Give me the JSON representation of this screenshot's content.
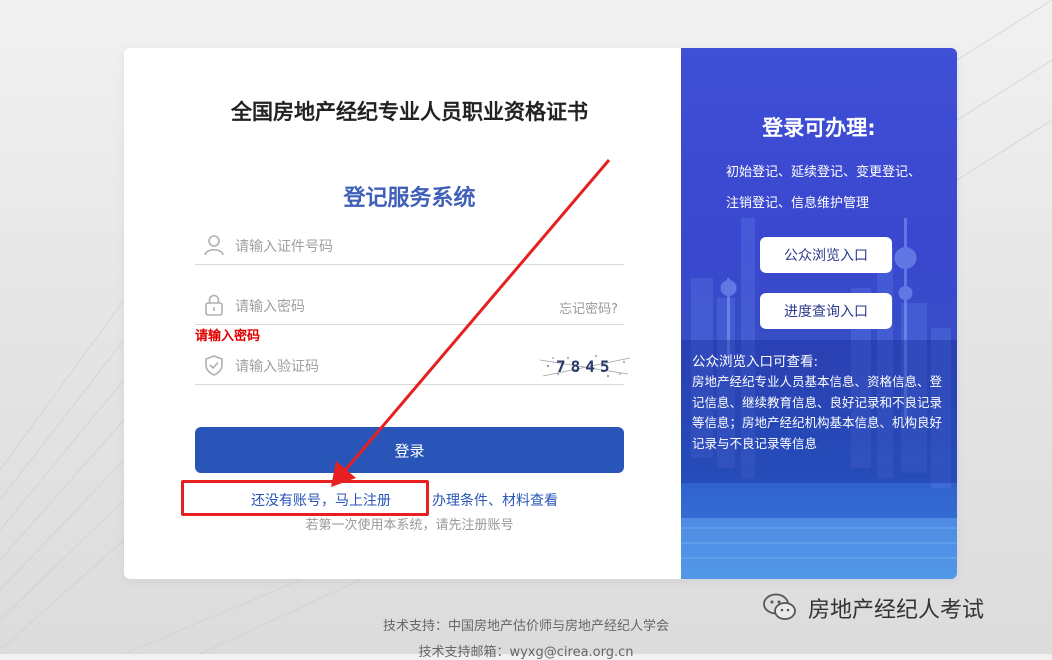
{
  "main_title": "全国房地产经纪专业人员职业资格证书",
  "sub_title": "登记服务系统",
  "form": {
    "id_placeholder": "请输入证件号码",
    "password_placeholder": "请输入密码",
    "forgot_password": "忘记密码?",
    "password_error": "请输入密码",
    "captcha_placeholder": "请输入验证码",
    "captcha_code": "7845",
    "login_button": "登录",
    "register_link": "还没有账号，马上注册",
    "conditions_link": "办理条件、材料查看",
    "hint": "若第一次使用本系统，请先注册账号"
  },
  "side": {
    "title": "登录可办理:",
    "lines": [
      "初始登记、延续登记、变更登记、",
      "注销登记、信息维护管理"
    ],
    "public_button": "公众浏览入口",
    "progress_button": "进度查询入口",
    "info_title": "公众浏览入口可查看:",
    "info_body": "房地产经纪专业人员基本信息、资格信息、登记信息、继续教育信息、良好记录和不良记录等信息；房地产经纪机构基本信息、机构良好记录与不良记录等信息"
  },
  "footer": {
    "support": "技术支持：中国房地产估价师与房地产经纪人学会",
    "email": "技术支持邮箱：wyxg@cirea.org.cn"
  },
  "watermark": "房地产经纪人考试",
  "colors": {
    "primary": "#2a55b8",
    "error": "#e00000",
    "annotation": "#e62020",
    "side_panel": "#3a47cf"
  }
}
